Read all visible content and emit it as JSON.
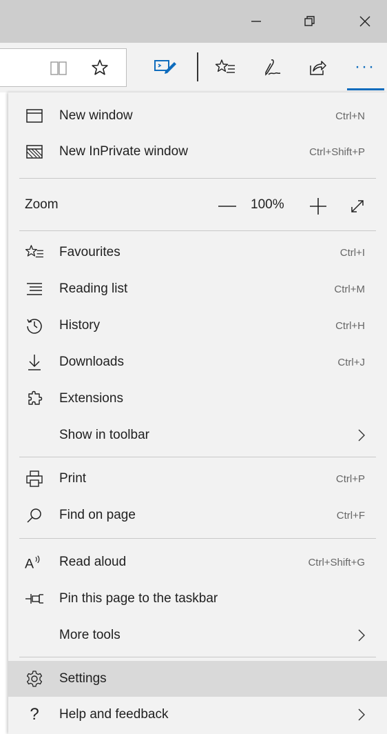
{
  "window": {
    "minimize_icon": "minimize-icon",
    "restore_icon": "restore-icon",
    "close_icon": "close-icon"
  },
  "toolbar": {
    "icons": [
      "reading-view-icon",
      "star-icon",
      "web-note-icon",
      "favourites-icon",
      "pen-icon",
      "share-icon",
      "ellipsis-icon"
    ],
    "ellipsis_label": "···",
    "accent": "#0f6cbd"
  },
  "menu": {
    "new_window": {
      "label": "New window",
      "shortcut": "Ctrl+N"
    },
    "new_inprivate": {
      "label": "New InPrivate window",
      "shortcut": "Ctrl+Shift+P"
    },
    "zoom": {
      "label": "Zoom",
      "value": "100%",
      "minus": "—",
      "plus": "+"
    },
    "favourites": {
      "label": "Favourites",
      "shortcut": "Ctrl+I"
    },
    "reading_list": {
      "label": "Reading list",
      "shortcut": "Ctrl+M"
    },
    "history": {
      "label": "History",
      "shortcut": "Ctrl+H"
    },
    "downloads": {
      "label": "Downloads",
      "shortcut": "Ctrl+J"
    },
    "extensions": {
      "label": "Extensions"
    },
    "show_in_toolbar": {
      "label": "Show in toolbar"
    },
    "print": {
      "label": "Print",
      "shortcut": "Ctrl+P"
    },
    "find_on_page": {
      "label": "Find on page",
      "shortcut": "Ctrl+F"
    },
    "read_aloud": {
      "label": "Read aloud",
      "shortcut": "Ctrl+Shift+G"
    },
    "pin_taskbar": {
      "label": "Pin this page to the taskbar"
    },
    "more_tools": {
      "label": "More tools"
    },
    "settings": {
      "label": "Settings"
    },
    "help_feedback": {
      "label": "Help and feedback",
      "help_glyph": "?"
    }
  }
}
